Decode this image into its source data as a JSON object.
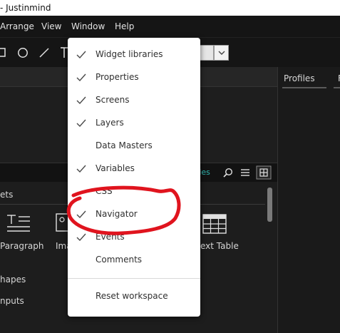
{
  "window": {
    "title": "- Justinmind"
  },
  "menubar": {
    "items": [
      "Arrange",
      "View",
      "Window",
      "Help"
    ]
  },
  "right_panel": {
    "tabs": [
      "Profiles",
      "F"
    ]
  },
  "library": {
    "tab_link": "aries",
    "section": "ets",
    "widgets": [
      "Paragraph",
      "Ima",
      "ext Table"
    ],
    "categories": [
      "hapes",
      "nputs"
    ]
  },
  "window_menu": {
    "items": [
      {
        "label": "Widget libraries",
        "checked": true
      },
      {
        "label": "Properties",
        "checked": true
      },
      {
        "label": "Screens",
        "checked": true
      },
      {
        "label": "Layers",
        "checked": true
      },
      {
        "label": "Data Masters",
        "checked": false
      },
      {
        "label": "Variables",
        "checked": true
      },
      {
        "label": "CSS",
        "checked": false
      },
      {
        "label": "Navigator",
        "checked": true
      },
      {
        "label": "Events",
        "checked": true
      },
      {
        "label": "Comments",
        "checked": false
      }
    ],
    "reset": "Reset workspace"
  },
  "colors": {
    "accent": "#2fb6b0",
    "annotation": "#e0141e",
    "menu_bg": "#ffffff",
    "app_bg": "#1b1b1b"
  },
  "icons": [
    "rectangle-icon",
    "circle-icon",
    "line-icon",
    "text-icon",
    "chevron-down-icon",
    "search-icon",
    "list-view-icon",
    "grid-view-icon",
    "paragraph-icon",
    "image-icon",
    "table-icon",
    "checkmark-icon"
  ]
}
